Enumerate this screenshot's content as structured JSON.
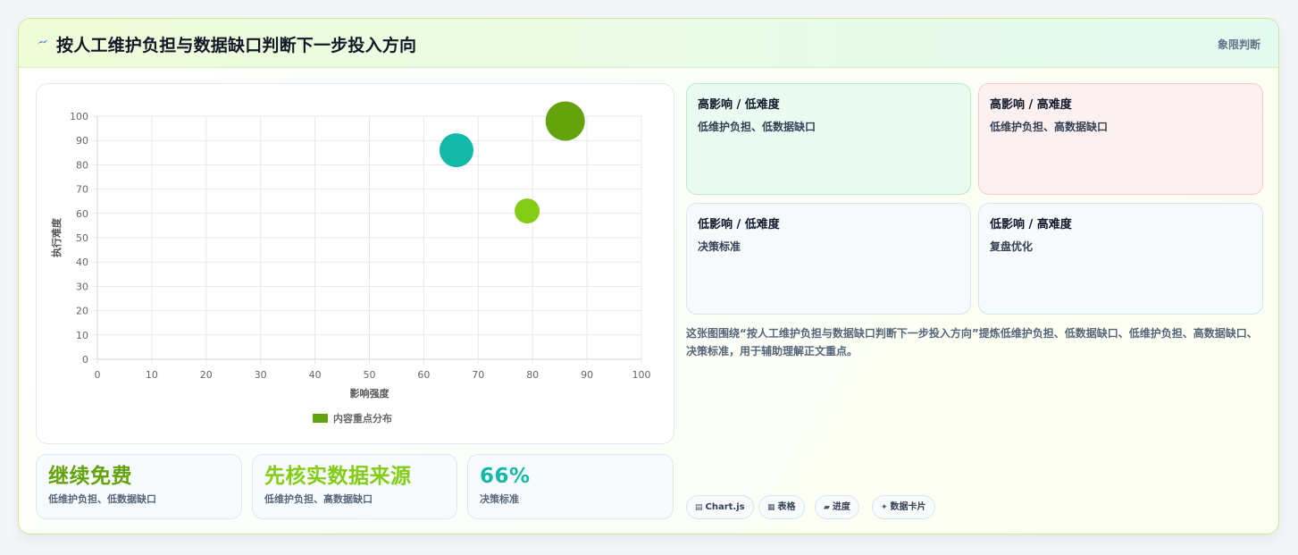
{
  "header": {
    "title": "按人工维护负担与数据缺口判断下一步投入方向",
    "tag": "象限判断"
  },
  "chart_data": {
    "type": "scatter",
    "xlabel": "影响强度",
    "ylabel": "执行难度",
    "xlim": [
      0,
      100
    ],
    "ylim": [
      0,
      100
    ],
    "xticks": [
      0,
      10,
      20,
      30,
      40,
      50,
      60,
      70,
      80,
      90,
      100
    ],
    "yticks": [
      0,
      10,
      20,
      30,
      40,
      50,
      60,
      70,
      80,
      90,
      100
    ],
    "grid": true,
    "legend_position": "bottom",
    "series": [
      {
        "name": "内容重点分布",
        "color": "#65a30d",
        "points": [
          {
            "x": 66,
            "y": 86,
            "r": 19,
            "color": "#14b8a6"
          },
          {
            "x": 79,
            "y": 61,
            "r": 14,
            "color": "#84cc16"
          },
          {
            "x": 86,
            "y": 98,
            "r": 22,
            "color": "#65a30d"
          }
        ]
      }
    ]
  },
  "quadrants": [
    {
      "title": "高影响 / 低难度",
      "body": "低维护负担、低数据缺口"
    },
    {
      "title": "高影响 / 高难度",
      "body": "低维护负担、高数据缺口"
    },
    {
      "title": "低影响 / 低难度",
      "body": "决策标准"
    },
    {
      "title": "低影响 / 高难度",
      "body": "复盘优化"
    }
  ],
  "description": "这张图围绕“按人工维护负担与数据缺口判断下一步投入方向”提炼低维护负担、低数据缺口、低维护负担、高数据缺口、决策标准，用于辅助理解正文重点。",
  "metrics": [
    {
      "value": "继续免费",
      "sub": "低维护负担、低数据缺口",
      "color": "#65a30d"
    },
    {
      "value": "先核实数据来源",
      "sub": "低维护负担、高数据缺口",
      "color": "#84cc16"
    },
    {
      "value": "66%",
      "sub": "决策标准",
      "color": "#14b8a6"
    }
  ],
  "chips": [
    {
      "icon": "▤",
      "icon_name": "chart-icon",
      "label": "Chart.js"
    },
    {
      "icon": "▦",
      "icon_name": "table-icon",
      "label": "表格"
    },
    {
      "icon": "▰",
      "icon_name": "progress-icon",
      "label": "进度"
    },
    {
      "icon": "✦",
      "icon_name": "sparkle-icon",
      "label": "数据卡片"
    }
  ],
  "colors": {
    "accent_green": "#65a30d",
    "accent_lime": "#84cc16",
    "accent_teal": "#14b8a6",
    "bolt": "#2563eb"
  }
}
